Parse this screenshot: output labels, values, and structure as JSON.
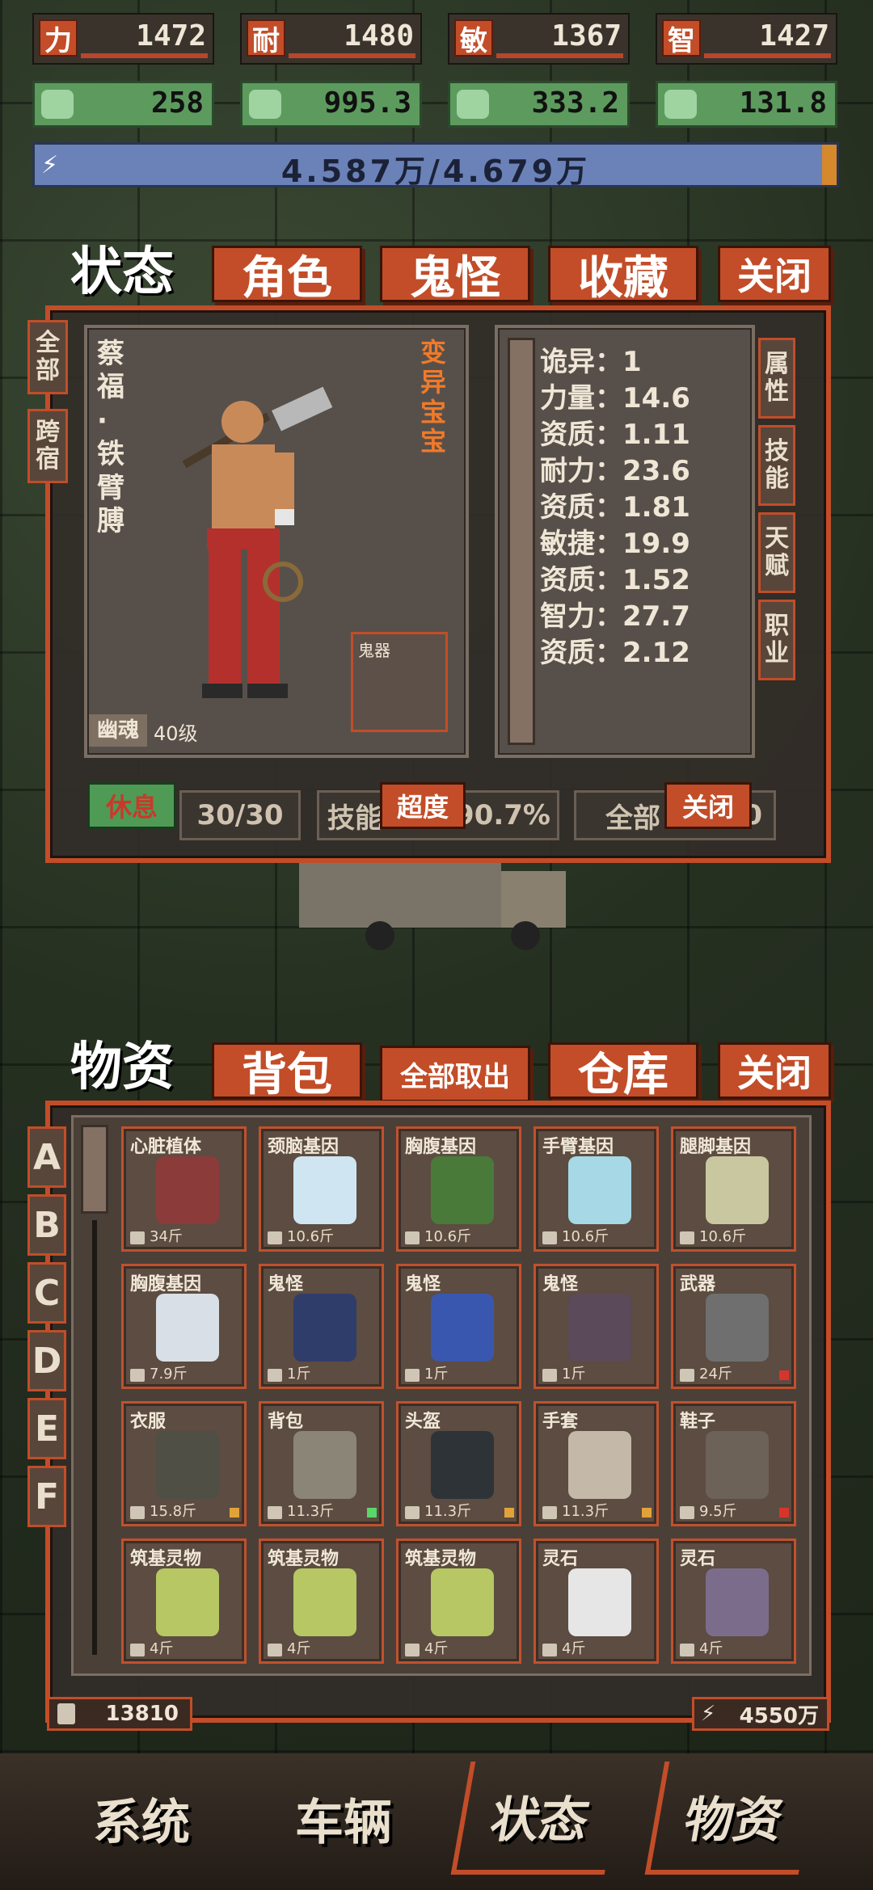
{
  "stats": [
    {
      "label": "力",
      "value": "1472"
    },
    {
      "label": "耐",
      "value": "1480"
    },
    {
      "label": "敏",
      "value": "1367"
    },
    {
      "label": "智",
      "value": "1427"
    }
  ],
  "gear_stats": [
    "258",
    "995.3",
    "333.2",
    "131.8"
  ],
  "energy": "4.587万/4.679万",
  "status_tabs": {
    "status": "状态",
    "role": "角色",
    "ghost": "鬼怪",
    "collect": "收藏",
    "close": "关闭"
  },
  "left_tabs": [
    "全部",
    "跨宿"
  ],
  "right_tabs": [
    "属性",
    "技能",
    "天赋",
    "职业"
  ],
  "character": {
    "name": "蔡福·铁臂膊",
    "mutation": "变异宝宝",
    "ghost_slot": "鬼器",
    "type": "幽魂",
    "level": "40级",
    "attrs": [
      {
        "k": "诡异",
        "v": "1"
      },
      {
        "k": "力量",
        "v": "14.6"
      },
      {
        "k": "资质",
        "v": "1.11"
      },
      {
        "k": "耐力",
        "v": "23.6"
      },
      {
        "k": "资质",
        "v": "1.81"
      },
      {
        "k": "敏捷",
        "v": "19.9"
      },
      {
        "k": "资质",
        "v": "1.52"
      },
      {
        "k": "智力",
        "v": "27.7"
      },
      {
        "k": "资质",
        "v": "2.12"
      }
    ]
  },
  "status_footer": {
    "rest": "休息",
    "count": "30/30",
    "skill": "技能",
    "overdo": "超度",
    "percent": "90.7%",
    "all": "全部",
    "close": "关闭",
    "tail": "50"
  },
  "inv_tabs": {
    "supplies": "物资",
    "bag": "背包",
    "take_all": "全部取出",
    "warehouse": "仓库",
    "close": "关闭"
  },
  "rows": [
    "A",
    "B",
    "C",
    "D",
    "E",
    "F"
  ],
  "items": [
    {
      "name": "心脏植体",
      "w": "34斤",
      "color": "#8c3b3b",
      "q": ""
    },
    {
      "name": "颈脑基因",
      "w": "10.6斤",
      "color": "#cfe6f2",
      "q": ""
    },
    {
      "name": "胸腹基因",
      "w": "10.6斤",
      "color": "#4a7a3a",
      "q": ""
    },
    {
      "name": "手臂基因",
      "w": "10.6斤",
      "color": "#a6d8e6",
      "q": ""
    },
    {
      "name": "腿脚基因",
      "w": "10.6斤",
      "color": "#c9c7a0",
      "q": ""
    },
    {
      "name": "胸腹基因",
      "w": "7.9斤",
      "color": "#d9dfe6",
      "q": ""
    },
    {
      "name": "鬼怪",
      "w": "1斤",
      "color": "#2f3d6a",
      "q": ""
    },
    {
      "name": "鬼怪",
      "w": "1斤",
      "color": "#3a57b0",
      "q": ""
    },
    {
      "name": "鬼怪",
      "w": "1斤",
      "color": "#5a4a5a",
      "q": ""
    },
    {
      "name": "武器",
      "w": "24斤",
      "color": "#6f6f6f",
      "q": "#d9342b"
    },
    {
      "name": "衣服",
      "w": "15.8斤",
      "color": "#4f4f45",
      "q": "#e2a23a"
    },
    {
      "name": "背包",
      "w": "11.3斤",
      "color": "#8a8577",
      "q": "#5ad66a"
    },
    {
      "name": "头盔",
      "w": "11.3斤",
      "color": "#2e3338",
      "q": "#e2a23a"
    },
    {
      "name": "手套",
      "w": "11.3斤",
      "color": "#c4b8a8",
      "q": "#e2a23a"
    },
    {
      "name": "鞋子",
      "w": "9.5斤",
      "color": "#6c6258",
      "q": "#d9342b"
    },
    {
      "name": "筑基灵物",
      "w": "4斤",
      "color": "#b6c764",
      "q": ""
    },
    {
      "name": "筑基灵物",
      "w": "4斤",
      "color": "#b6c764",
      "q": ""
    },
    {
      "name": "筑基灵物",
      "w": "4斤",
      "color": "#b6c764",
      "q": ""
    },
    {
      "name": "灵石",
      "w": "4斤",
      "color": "#e6e6e6",
      "q": ""
    },
    {
      "name": "灵石",
      "w": "4斤",
      "color": "#7c6c8c",
      "q": ""
    }
  ],
  "inv_footer": {
    "left": "13810",
    "right": "4550万"
  },
  "nav": [
    "系统",
    "车辆",
    "状态",
    "物资"
  ]
}
